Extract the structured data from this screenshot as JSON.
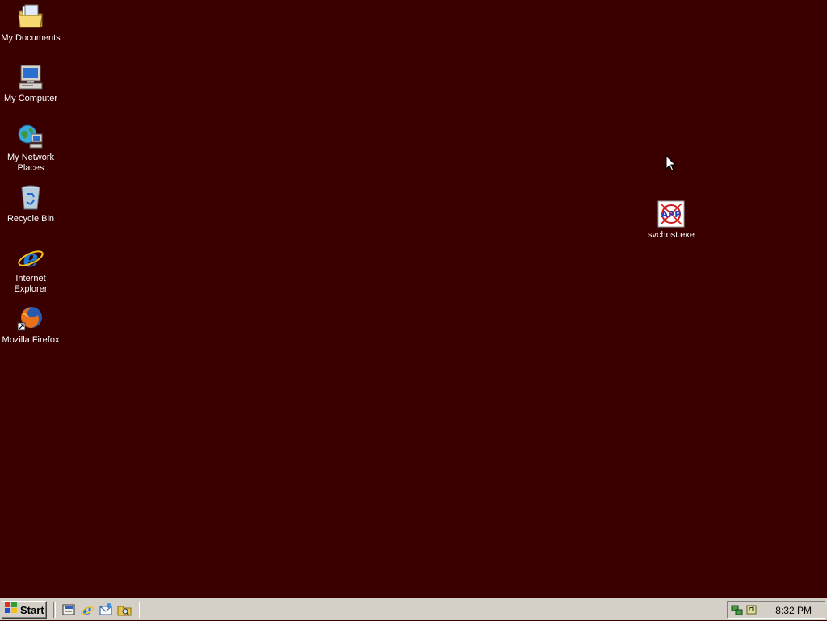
{
  "desktop": {
    "background_color": "#3a0000",
    "icons": [
      {
        "label": "My Documents",
        "icon": "folder-documents-icon"
      },
      {
        "label": "My Computer",
        "icon": "computer-icon"
      },
      {
        "label": "My Network Places",
        "icon": "network-places-icon"
      },
      {
        "label": "Recycle Bin",
        "icon": "recycle-bin-icon"
      },
      {
        "label": "Internet Explorer",
        "icon": "internet-explorer-icon"
      },
      {
        "label": "Mozilla Firefox",
        "icon": "firefox-icon"
      },
      {
        "label": "svchost.exe",
        "icon": "svchost-exe-icon"
      }
    ]
  },
  "taskbar": {
    "start_label": "Start",
    "quick_launch": [
      {
        "icon": "show-desktop-icon"
      },
      {
        "icon": "internet-explorer-icon"
      },
      {
        "icon": "outlook-express-icon"
      },
      {
        "icon": "explorer-icon"
      }
    ],
    "tray": {
      "icons": [
        "network-tray-icon",
        "volume-tray-icon"
      ],
      "clock": "8:32 PM"
    }
  }
}
